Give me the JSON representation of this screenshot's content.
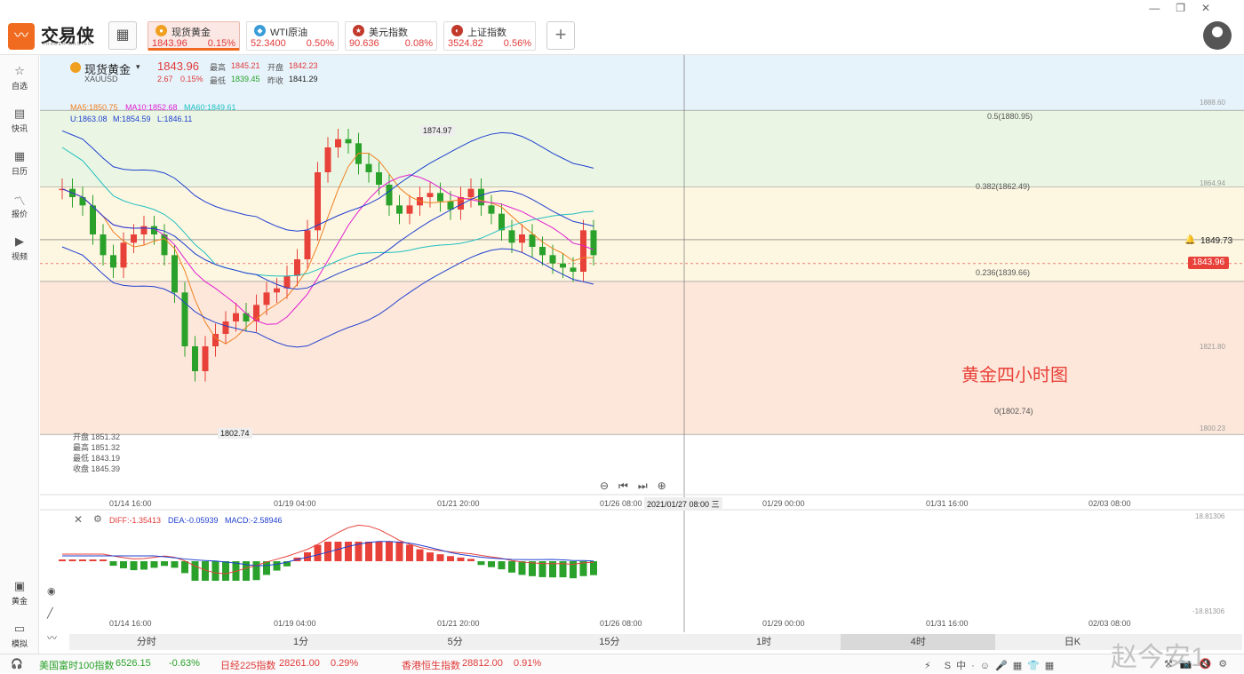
{
  "app": {
    "name": "交易侠",
    "sub": "TRADER MASTER"
  },
  "tabs": [
    {
      "name": "现货黄金",
      "price": "1843.96",
      "pct": "0.15%",
      "icon": "gold-icon",
      "color": "#f0a020"
    },
    {
      "name": "WTI原油",
      "price": "52.3400",
      "pct": "0.50%",
      "icon": "oil-icon",
      "color": "#3a9bd9"
    },
    {
      "name": "美元指数",
      "price": "90.636",
      "pct": "0.08%",
      "icon": "usa-flag-icon",
      "color": "#c0392b"
    },
    {
      "name": "上证指数",
      "price": "3524.82",
      "pct": "0.56%",
      "icon": "sse-icon",
      "color": "#c0392b"
    }
  ],
  "sidebar": [
    {
      "label": "自选",
      "icon": "star-icon"
    },
    {
      "label": "快讯",
      "icon": "news-icon"
    },
    {
      "label": "日历",
      "icon": "calendar-icon"
    },
    {
      "label": "报价",
      "icon": "quote-icon"
    },
    {
      "label": "视频",
      "icon": "video-icon"
    },
    {
      "label": "黄金",
      "icon": "gold-calc-icon"
    },
    {
      "label": "模拟",
      "icon": "wallet-icon"
    }
  ],
  "header": {
    "symbol_name": "现货黄金",
    "symbol_code": "XAUUSD",
    "price": "1843.96",
    "change": "2.67",
    "change_pct": "0.15%",
    "high_label": "最高",
    "high": "1845.21",
    "open_label": "开盘",
    "open": "1842.23",
    "low_label": "最低",
    "low": "1839.45",
    "prev_label": "昨收",
    "prev": "1841.29",
    "ma5": "MA5:1850.75",
    "ma10": "MA10:1852.68",
    "ma60": "MA60:1849.61",
    "boll_u": "U:1863.08",
    "boll_m": "M:1854.59",
    "boll_l": "L:1846.11"
  },
  "ohlc_box": [
    "开盘 1851.32",
    "最高 1851.32",
    "最低 1843.19",
    "收盘 1845.39"
  ],
  "fib": [
    "0.5(1880.95)",
    "0.382(1862.49)",
    "0.236(1839.66)",
    "0(1802.74)"
  ],
  "price_axis": [
    "1888.60",
    "1864.94",
    "1849.73",
    "1843.96",
    "1821.80",
    "1800.23"
  ],
  "annotations": {
    "peak": "1874.97",
    "trough": "1802.74",
    "title": "黄金四小时图",
    "crosshair_time": "2021/01/27 08:00 三"
  },
  "time_axis": [
    "01/14 16:00",
    "01/19 04:00",
    "01/21 20:00",
    "01/26 08:00",
    "01/29 00:00",
    "01/31 16:00",
    "02/03 08:00"
  ],
  "macd": {
    "diff": "DIFF:-1.35413",
    "dea": "DEA:-0.05939",
    "macd": "MACD:-2.58946",
    "top": "18.81306",
    "bottom": "-18.81306"
  },
  "periods": [
    "分时",
    "1分",
    "5分",
    "15分",
    "1时",
    "4时",
    "日K"
  ],
  "active_period": "4时",
  "status": [
    {
      "name": "美国富时100指数",
      "value": "6526.15",
      "pct": "-0.63%"
    },
    {
      "name": "日经225指数",
      "value": "28261.00",
      "pct": "0.29%"
    },
    {
      "name": "香港恒生指数",
      "value": "28812.00",
      "pct": "0.91%"
    }
  ],
  "watermark": "赵今安1",
  "chart_data": {
    "type": "candlestick",
    "title": "黄金四小时图",
    "series": [
      {
        "name": "XAUUSD",
        "values": [
          1862,
          1860,
          1858,
          1851,
          1846,
          1843,
          1849,
          1851,
          1853,
          1851,
          1846,
          1837,
          1824,
          1818,
          1824,
          1827,
          1830,
          1832,
          1830,
          1834,
          1837,
          1838,
          1841,
          1845,
          1852,
          1866,
          1872,
          1874,
          1873,
          1868,
          1866,
          1863,
          1858,
          1856,
          1858,
          1860,
          1861,
          1859,
          1857,
          1860,
          1862,
          1858,
          1856,
          1852,
          1849,
          1851,
          1848,
          1846,
          1844,
          1843,
          1842,
          1852,
          1846
        ]
      }
    ],
    "ylim": [
      1800,
      1890
    ]
  }
}
